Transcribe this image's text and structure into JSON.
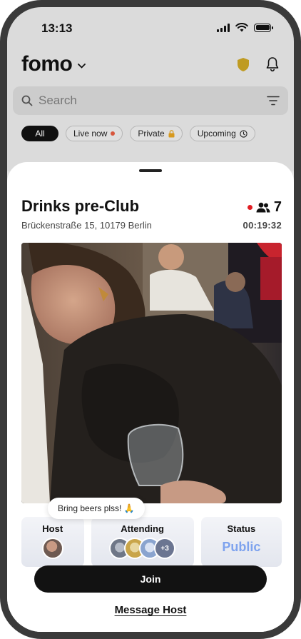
{
  "status_bar": {
    "time": "13:13"
  },
  "app": {
    "logo": "fomo"
  },
  "search": {
    "placeholder": "Search"
  },
  "filters": [
    {
      "label": "All",
      "active": true
    },
    {
      "label": "Live now"
    },
    {
      "label": "Private"
    },
    {
      "label": "Upcoming"
    }
  ],
  "event": {
    "title": "Drinks pre-Club",
    "address": "Brückenstraße 15, 10179 Berlin",
    "attendee_count": "7",
    "timer": "00:19:32",
    "host_note": "Bring beers plss! 🙏",
    "cards": {
      "host_label": "Host",
      "attending_label": "Attending",
      "attending_extra": "+3",
      "status_label": "Status",
      "status_value": "Public"
    }
  },
  "actions": {
    "join": "Join",
    "message_host": "Message Host"
  },
  "colors": {
    "live_red": "#e11d23",
    "status_blue": "#7ea3ee",
    "shield_gold": "#c7a224",
    "button_dark": "#121212"
  }
}
